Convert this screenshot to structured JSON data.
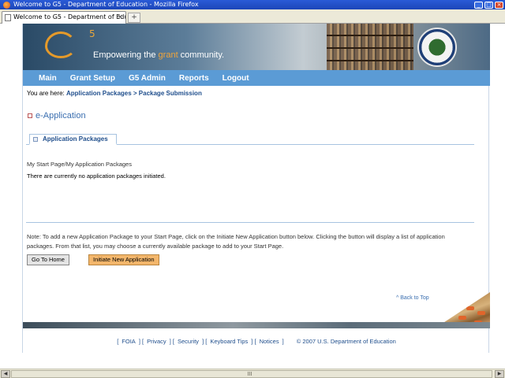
{
  "window": {
    "title": "Welcome to G5 - Department of Education - Mozilla Firefox",
    "controls": [
      "minimize-icon",
      "maximize-icon",
      "close-icon"
    ]
  },
  "browser": {
    "tab_title": "Welcome to G5 - Department of Edu...",
    "new_tab_label": "+"
  },
  "header": {
    "logo_text": "5",
    "tagline_prefix": "Empowering the ",
    "tagline_highlight": "grant",
    "tagline_suffix": " community.",
    "seal_icon": "department-of-education-seal"
  },
  "nav": {
    "items": [
      {
        "label": "Main"
      },
      {
        "label": "Grant Setup"
      },
      {
        "label": "G5 Admin"
      },
      {
        "label": "Reports"
      },
      {
        "label": "Logout"
      }
    ]
  },
  "breadcrumb": {
    "prefix": "You are here:",
    "path": "Application Packages > Package Submission"
  },
  "section": {
    "title": "e-Application"
  },
  "panel": {
    "tab_label": "Application Packages",
    "caption": "My Start Page/My Application Packages",
    "empty_message": "There are currently no application packages initiated."
  },
  "note": {
    "text": "Note: To add a new Application Package to your Start Page, click on the Initiate New Application button below. Clicking the button will display a list of application packages. From that list, you may choose a currently available package to add to your Start Page."
  },
  "buttons": {
    "go_home": "Go To Home",
    "initiate": "Initiate New Application"
  },
  "back_to_top": "^ Back to Top",
  "footer": {
    "links": [
      "FOIA",
      "Privacy",
      "Security",
      "Keyboard Tips",
      "Notices"
    ],
    "copyright": "© 2007 U.S. Department of Education"
  },
  "colors": {
    "nav_bg": "#5b9bd5",
    "link": "#1f4e8c",
    "accent_orange": "#f3b66b"
  }
}
